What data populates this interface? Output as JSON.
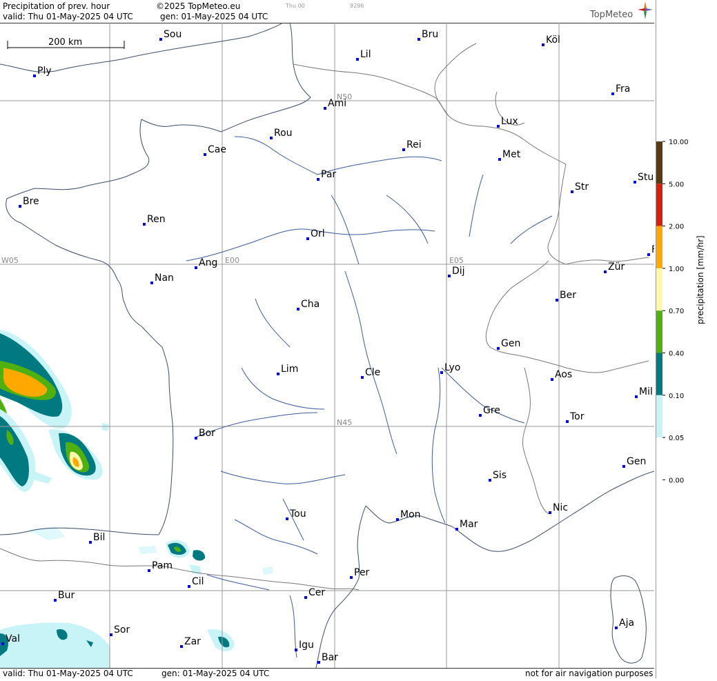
{
  "header": {
    "product": "Precipitation of prev. hour",
    "copyright": "©2025 TopMeteo.eu",
    "valid_line": "valid:  Thu  01-May-2025  04 UTC",
    "gen_line": "gen: 01-May-2025 04 UTC",
    "tiny_1": "Thu 00",
    "tiny_2": "9296",
    "logo": "TopMeteo"
  },
  "scale_bar": "200 km",
  "grid_labels": [
    "N50",
    "N45",
    "W05",
    "E00",
    "E05"
  ],
  "cities": [
    {
      "name": "Sou"
    },
    {
      "name": "Bru"
    },
    {
      "name": "Köl"
    },
    {
      "name": "Ply"
    },
    {
      "name": "Lil"
    },
    {
      "name": "Ami"
    },
    {
      "name": "Fra"
    },
    {
      "name": "Lux"
    },
    {
      "name": "Rou"
    },
    {
      "name": "Cae"
    },
    {
      "name": "Rei"
    },
    {
      "name": "Met"
    },
    {
      "name": "Par"
    },
    {
      "name": "Stu"
    },
    {
      "name": "Bre"
    },
    {
      "name": "Str"
    },
    {
      "name": "Ren"
    },
    {
      "name": "Orl"
    },
    {
      "name": "Ang"
    },
    {
      "name": "Dij"
    },
    {
      "name": "Zür"
    },
    {
      "name": "Nan"
    },
    {
      "name": "Ber"
    },
    {
      "name": "Cha"
    },
    {
      "name": "Gen"
    },
    {
      "name": "Lim"
    },
    {
      "name": "Cle"
    },
    {
      "name": "Lyo"
    },
    {
      "name": "Aos"
    },
    {
      "name": "Mil"
    },
    {
      "name": "Gre"
    },
    {
      "name": "Tor"
    },
    {
      "name": "Bor"
    },
    {
      "name": "Gen"
    },
    {
      "name": "Sis"
    },
    {
      "name": "Nic"
    },
    {
      "name": "Tou"
    },
    {
      "name": "Mon"
    },
    {
      "name": "Mar"
    },
    {
      "name": "Bil"
    },
    {
      "name": "Pam"
    },
    {
      "name": "Per"
    },
    {
      "name": "Cil"
    },
    {
      "name": "Cer"
    },
    {
      "name": "Bur"
    },
    {
      "name": "Sor"
    },
    {
      "name": "Aja"
    },
    {
      "name": "Val"
    },
    {
      "name": "Zar"
    },
    {
      "name": "Igu"
    },
    {
      "name": "Bar"
    },
    {
      "name": "F"
    }
  ],
  "footer": {
    "valid_line": "valid:  Thu  01-May-2025  04 UTC",
    "gen_line": "gen: 01-May-2025 04 UTC",
    "disclaimer": "not for air navigation purposes"
  },
  "legend": {
    "title": "precipitation [mm/hr]",
    "ticks": [
      "10.00",
      "5.00",
      "2.00",
      "1.00",
      "0.70",
      "0.40",
      "0.10",
      "0.05",
      "0.00"
    ],
    "colors": [
      "#5a3a12",
      "#d42010",
      "#ffa800",
      "#fff8a8",
      "#50b010",
      "#007a80",
      "#c8f4f8"
    ]
  },
  "colors": {
    "lines": "#3a5a9a",
    "border": "#777777",
    "grid": "#999999",
    "city_dot": "#0000dd"
  }
}
